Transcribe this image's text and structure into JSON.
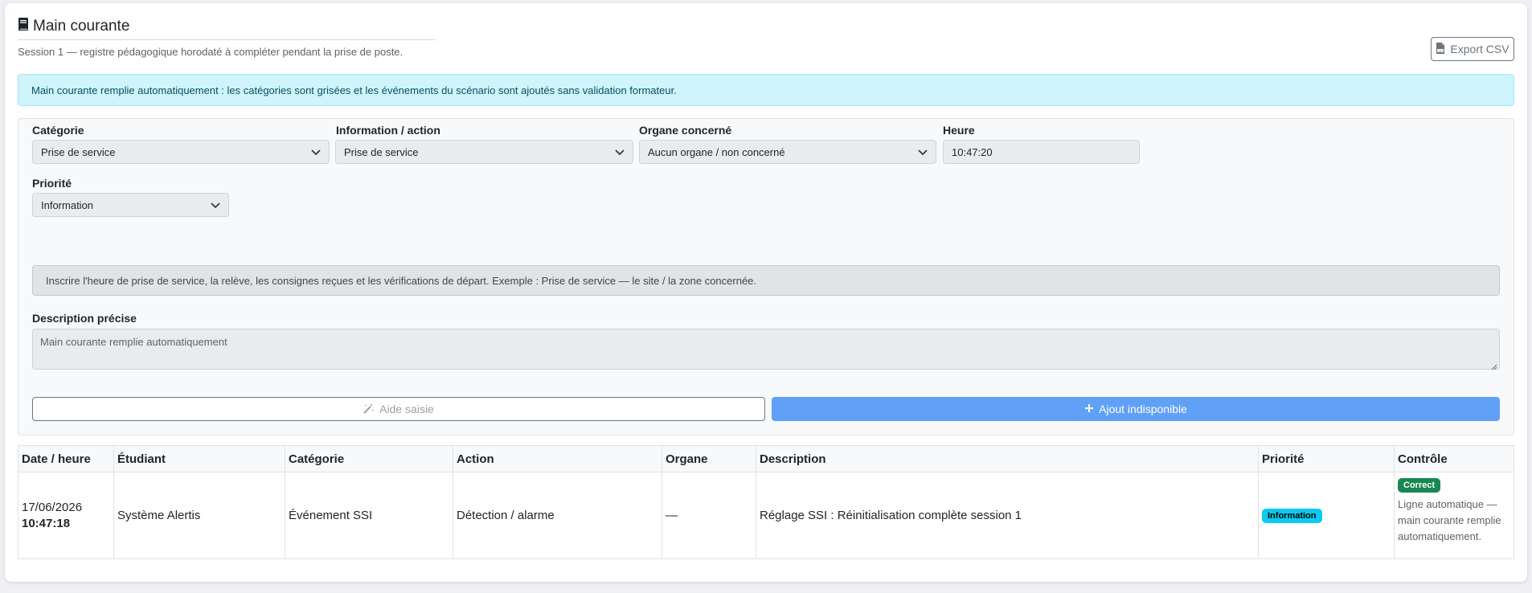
{
  "header": {
    "title": "Main courante",
    "subtitle": "Session 1 — registre pédagogique horodaté à compléter pendant la prise de poste.",
    "export_label": "Export CSV"
  },
  "alert": {
    "text": "Main courante remplie automatiquement : les catégories sont grisées et les événements du scénario sont ajoutés sans validation formateur."
  },
  "form": {
    "categorie": {
      "label": "Catégorie",
      "value": "Prise de service"
    },
    "information": {
      "label": "Information / action",
      "value": "Prise de service"
    },
    "organe": {
      "label": "Organe concerné",
      "value": "Aucun organe / non concerné"
    },
    "heure": {
      "label": "Heure",
      "value": "10:47:20"
    },
    "priorite": {
      "label": "Priorité",
      "value": "Information"
    },
    "hint": "Inscrire l'heure de prise de service, la relève, les consignes reçues et les vérifications de départ. Exemple : Prise de service — le site / la zone concernée.",
    "description": {
      "label": "Description précise",
      "value": "Main courante remplie automatiquement"
    },
    "aide_label": "Aide saisie",
    "ajout_label": "Ajout indisponible"
  },
  "table": {
    "headers": [
      "Date / heure",
      "Étudiant",
      "Catégorie",
      "Action",
      "Organe",
      "Description",
      "Priorité",
      "Contrôle"
    ],
    "rows": [
      {
        "date": "17/06/2026",
        "time": "10:47:18",
        "etudiant": "Système Alertis",
        "categorie": "Événement SSI",
        "action": "Détection / alarme",
        "organe": "—",
        "description": "Réglage SSI : Réinitialisation complète session 1",
        "priorite": "Information",
        "controle_badge": "Correct",
        "controle_note": "Ligne automatique — main courante remplie automatiquement."
      }
    ]
  },
  "colors": {
    "alert_bg": "#cff4fc",
    "primary_disabled": "#61a0f7",
    "badge_info": "#0dcaf0",
    "badge_success": "#198754"
  },
  "icons": {
    "title": "book-icon",
    "export": "file-csv-icon",
    "aide": "magic-wand-icon",
    "ajout": "plus-icon",
    "select": "chevron-down-icon"
  }
}
